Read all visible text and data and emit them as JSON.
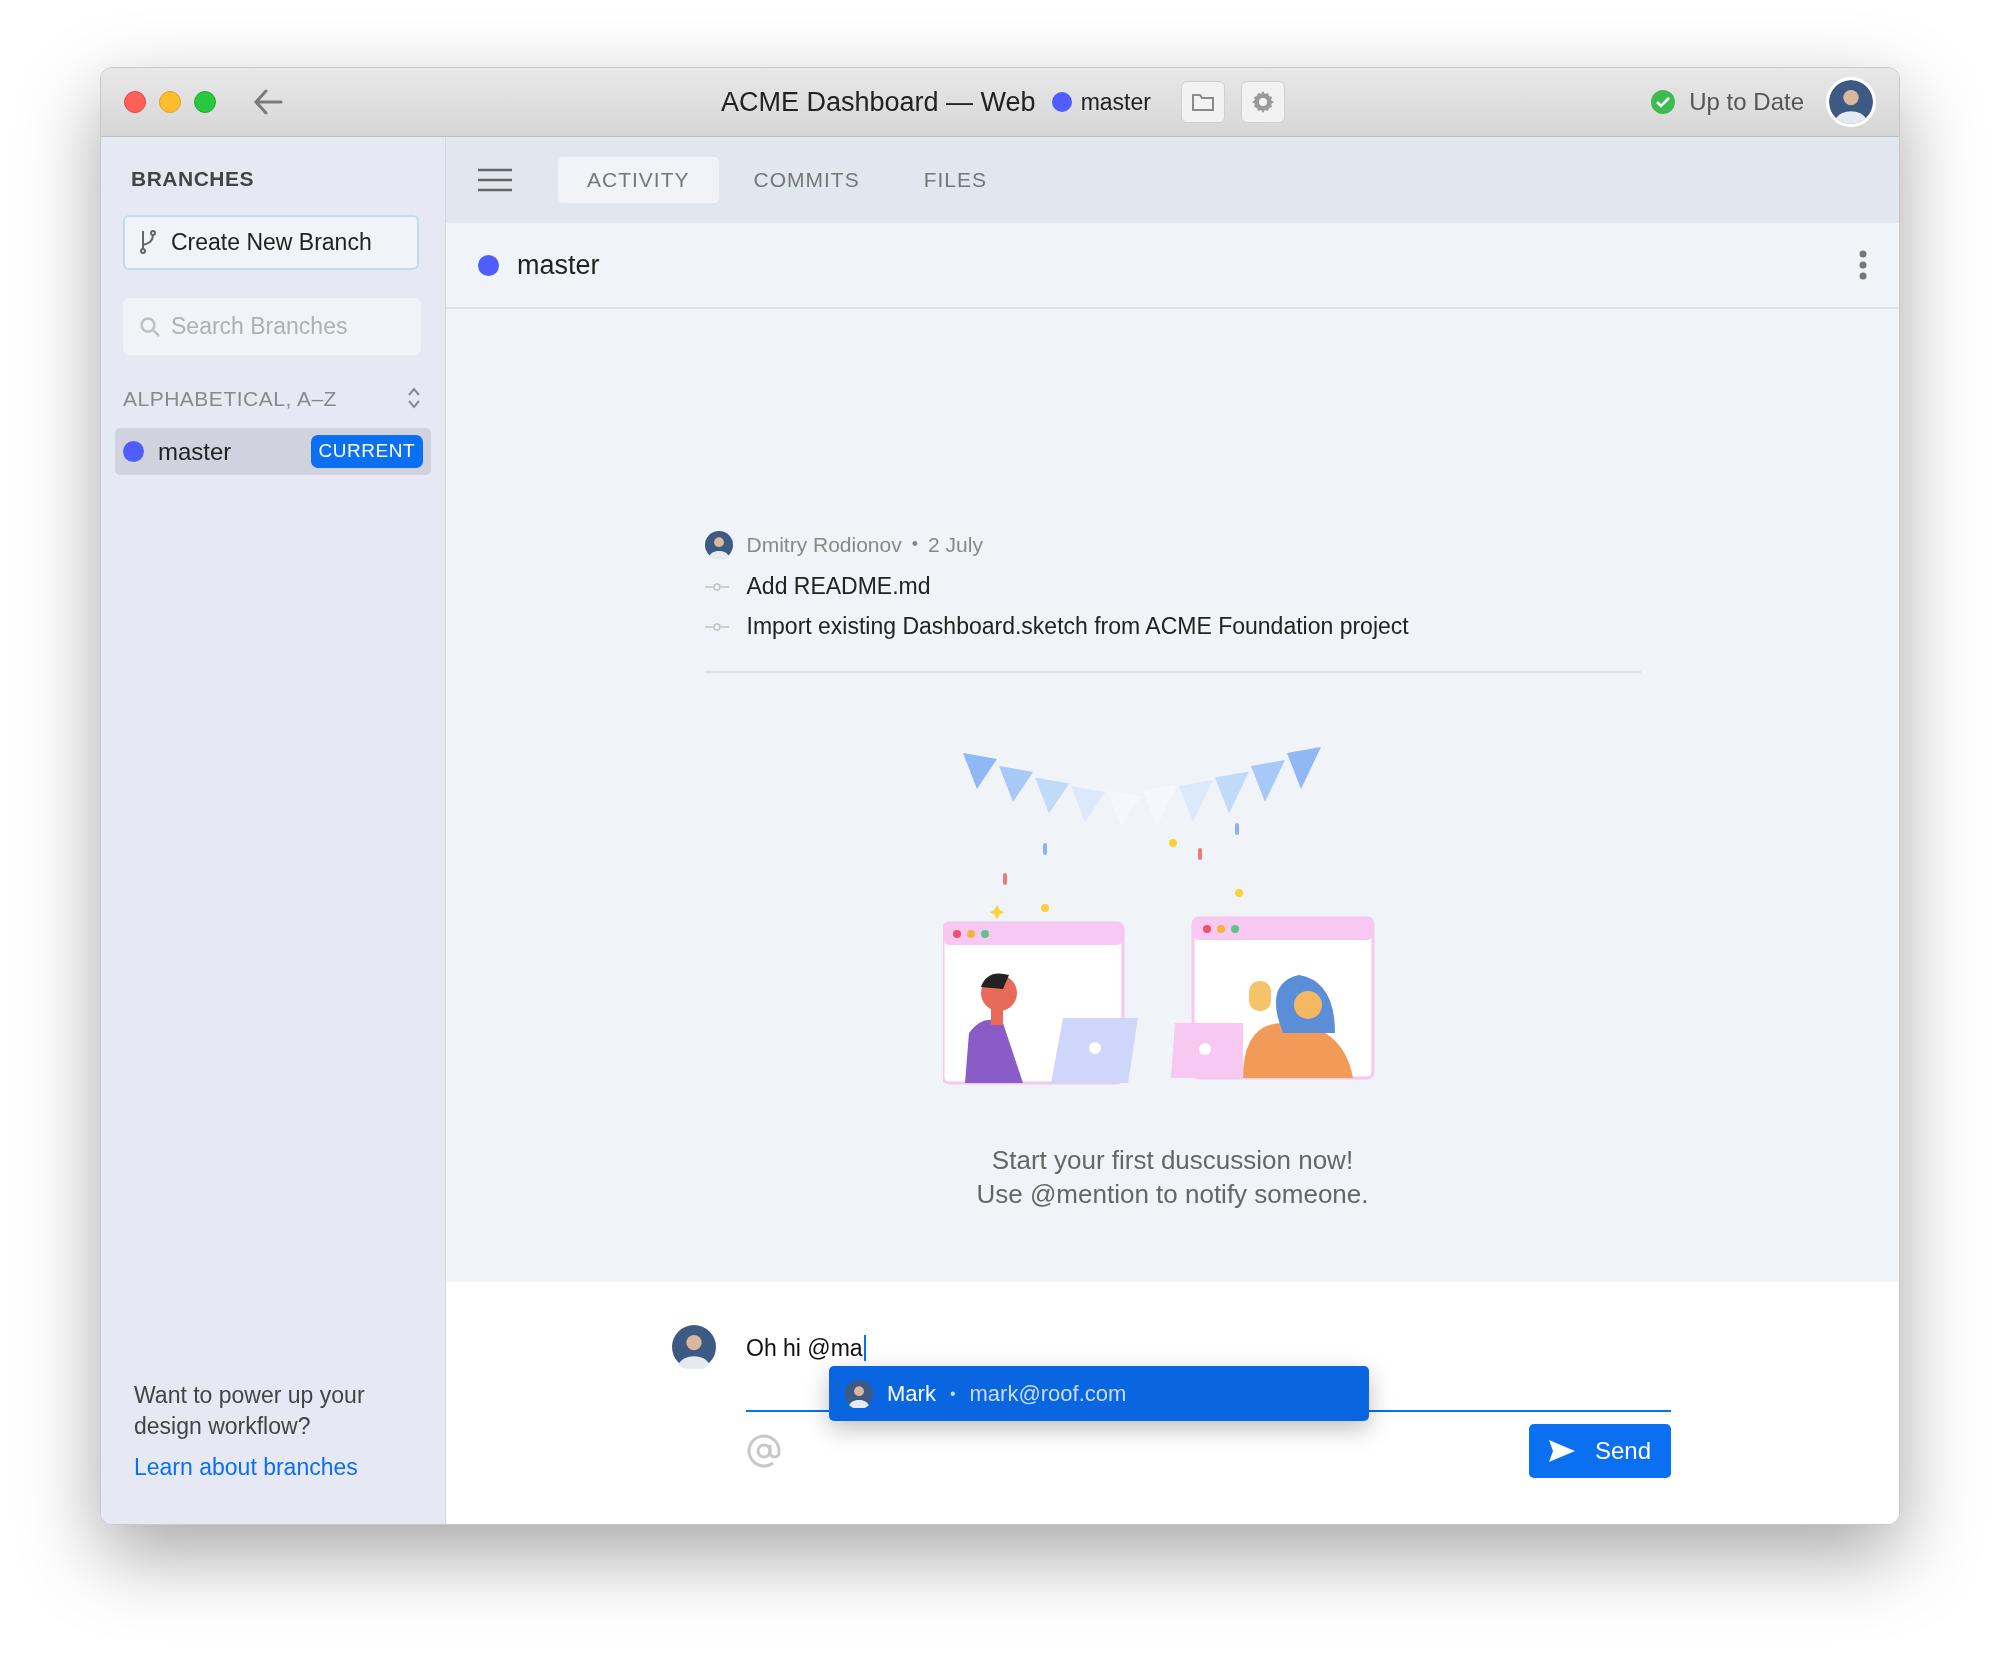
{
  "window": {
    "title": "ACME Dashboard — Web",
    "branch": {
      "name": "master",
      "color": "#4f5dff"
    },
    "status": {
      "label": "Up to Date",
      "ok": true
    }
  },
  "sidebar": {
    "heading": "BRANCHES",
    "create_button": "Create New Branch",
    "search": {
      "placeholder": "Search Branches"
    },
    "sort_label": "ALPHABETICAL, A–Z",
    "branches": [
      {
        "name": "master",
        "color": "#4f5dff",
        "badge": "CURRENT",
        "selected": true
      }
    ],
    "promo": "Want to power up your design workflow?",
    "promo_link": "Learn about branches"
  },
  "tabs": [
    {
      "label": "ACTIVITY",
      "selected": true
    },
    {
      "label": "COMMITS",
      "selected": false
    },
    {
      "label": "FILES",
      "selected": false
    }
  ],
  "branch_header": {
    "name": "master",
    "color": "#4f5dff"
  },
  "activity": {
    "author": "Dmitry Rodionov",
    "separator": "•",
    "date": "2 July",
    "commits": [
      "Add README.md",
      "Import existing Dashboard.sketch from ACME Foundation project"
    ]
  },
  "empty_state": [
    "Start your first duscussion now!",
    "Use @mention to notify someone."
  ],
  "composer": {
    "value": "Oh hi @ma",
    "suggestions": [
      {
        "name": "Mark",
        "separator": "•",
        "email": "mark@roof.com",
        "selected": true
      }
    ],
    "send": "Send"
  }
}
